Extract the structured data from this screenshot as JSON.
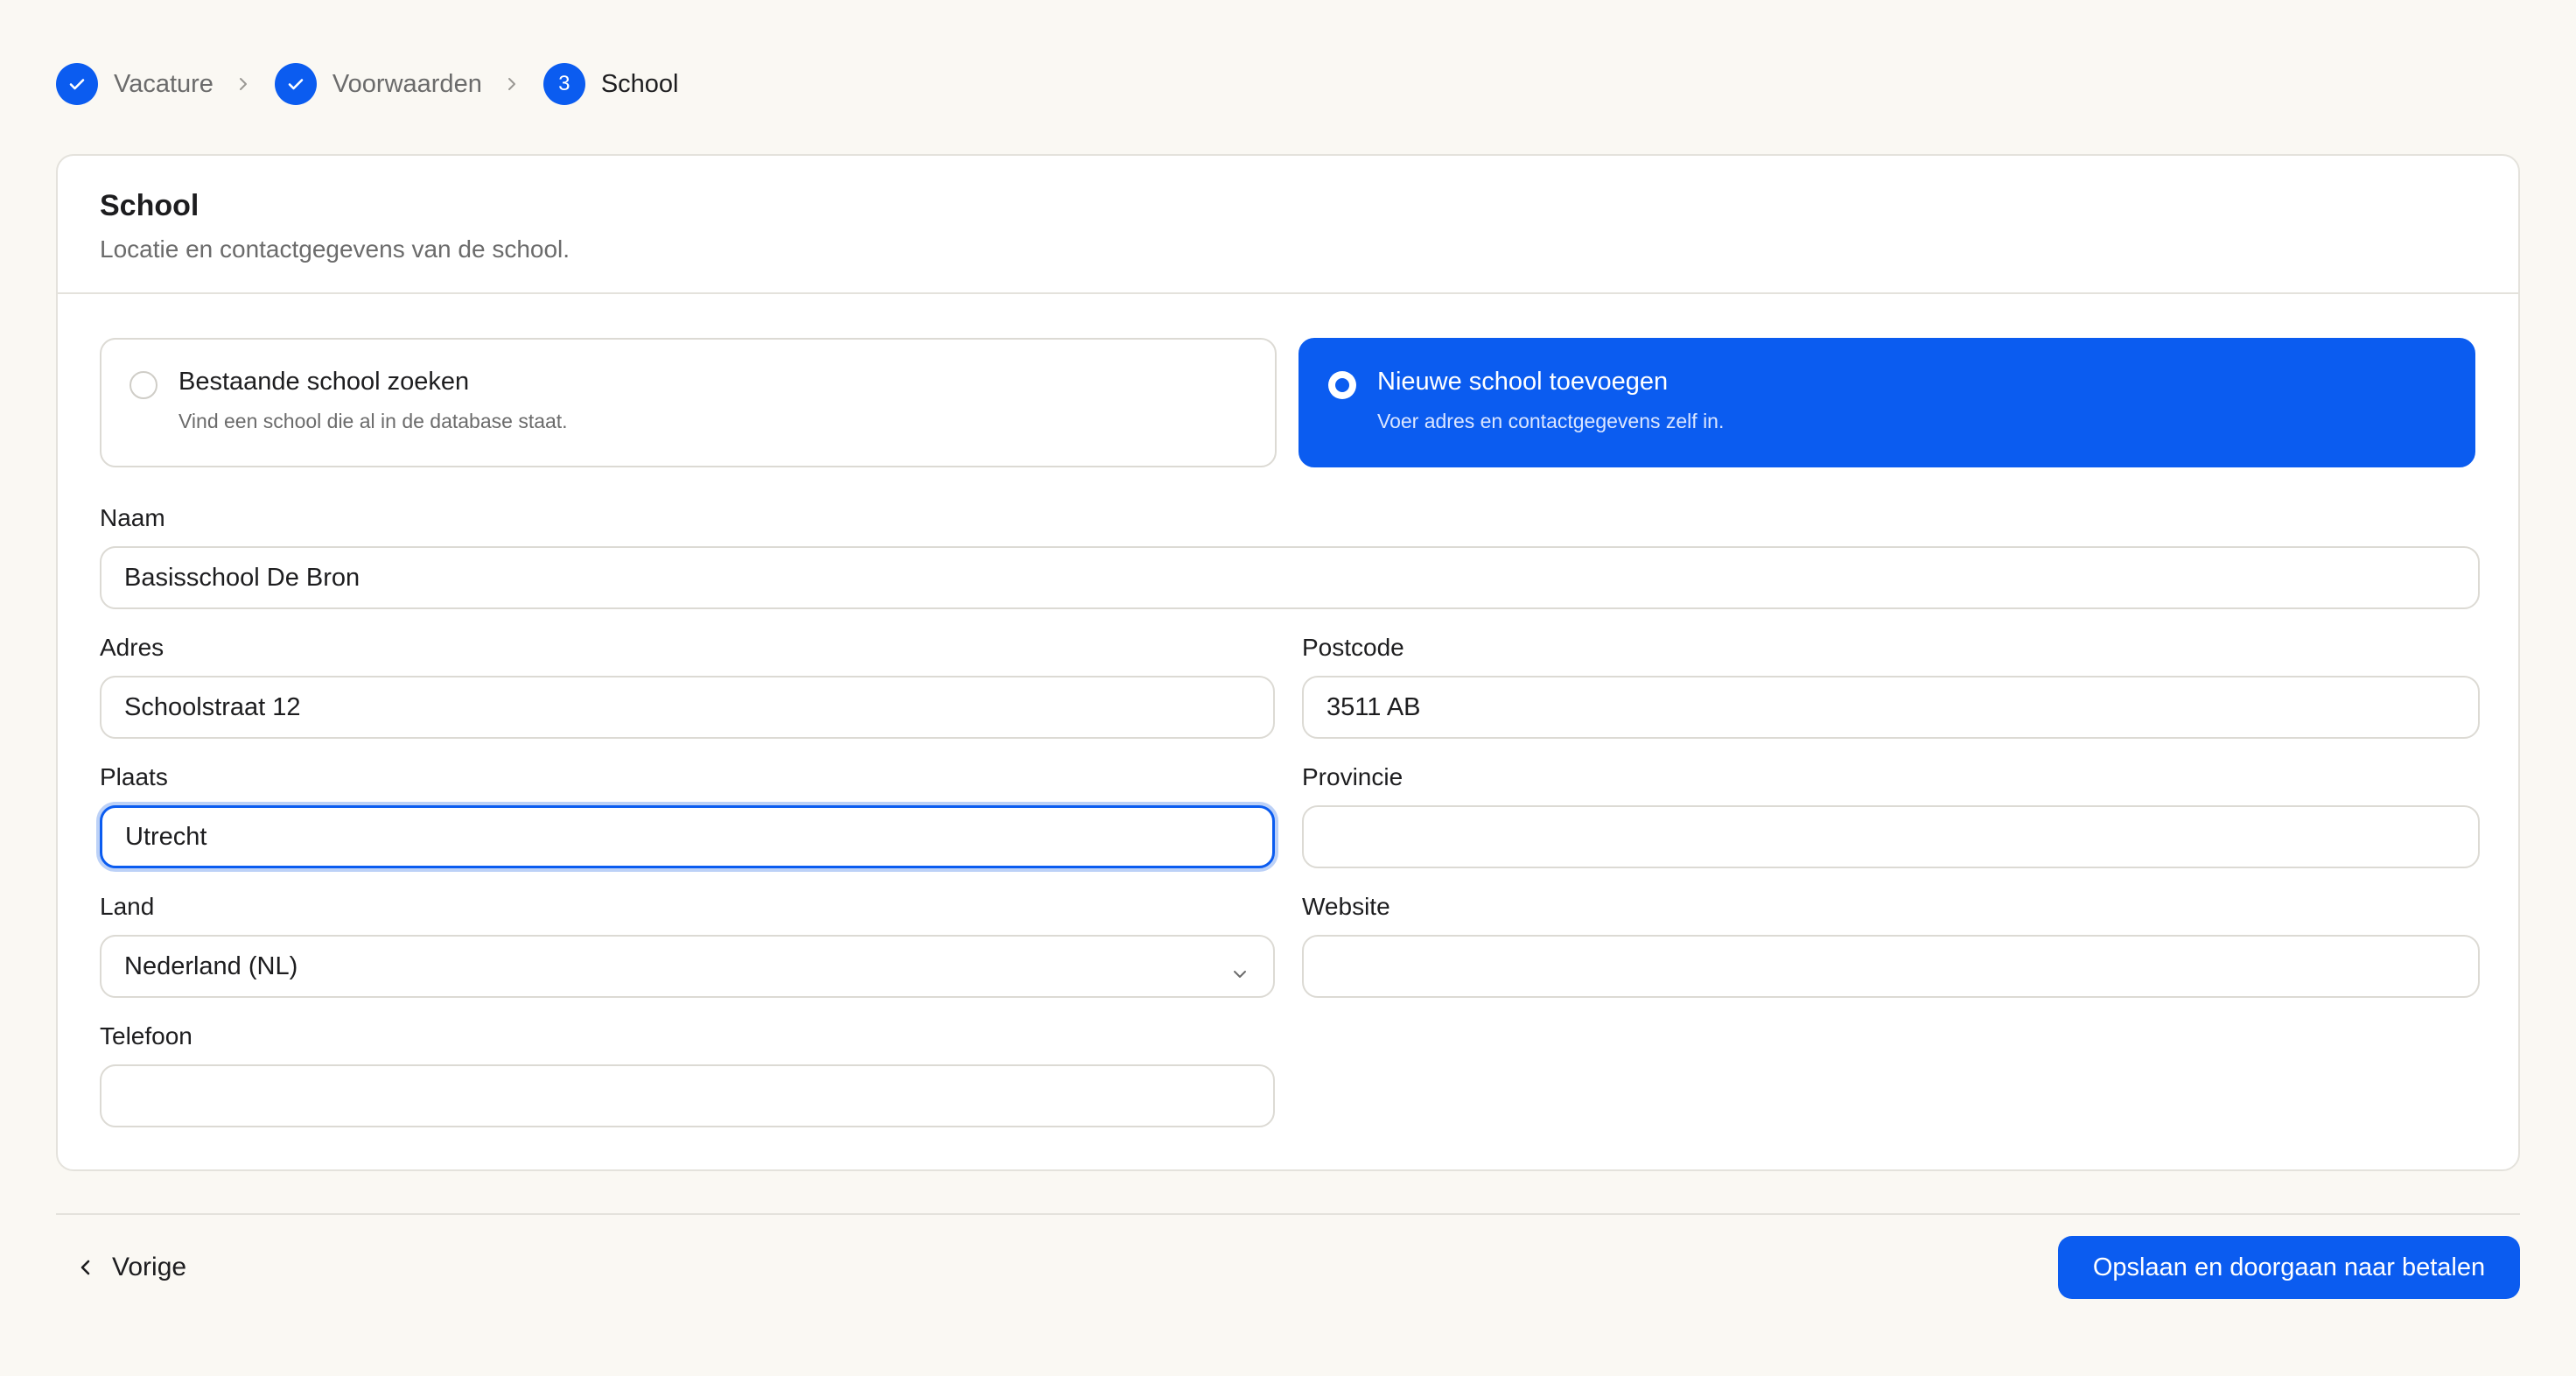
{
  "stepper": {
    "steps": [
      {
        "label": "Vacature",
        "state": "done"
      },
      {
        "label": "Voorwaarden",
        "state": "done"
      },
      {
        "label": "School",
        "state": "current",
        "number": "3"
      }
    ]
  },
  "card": {
    "title": "School",
    "subtitle": "Locatie en contactgegevens van de school."
  },
  "options": {
    "existing": {
      "title": "Bestaande school zoeken",
      "description": "Vind een school die al in de database staat.",
      "selected": false
    },
    "new": {
      "title": "Nieuwe school toevoegen",
      "description": "Voer adres en contactgegevens zelf in.",
      "selected": true
    }
  },
  "form": {
    "naam": {
      "label": "Naam",
      "value": "Basisschool De Bron"
    },
    "adres": {
      "label": "Adres",
      "value": "Schoolstraat 12"
    },
    "postcode": {
      "label": "Postcode",
      "value": "3511 AB"
    },
    "plaats": {
      "label": "Plaats",
      "value": "Utrecht"
    },
    "provincie": {
      "label": "Provincie",
      "value": ""
    },
    "land": {
      "label": "Land",
      "value": "Nederland (NL)"
    },
    "website": {
      "label": "Website",
      "value": ""
    },
    "telefoon": {
      "label": "Telefoon",
      "value": ""
    }
  },
  "footer": {
    "back_label": "Vorige",
    "submit_label": "Opslaan en doorgaan naar betalen"
  },
  "colors": {
    "accent": "#0b5cf0",
    "background": "#faf8f3",
    "border": "#e4e2dc"
  }
}
